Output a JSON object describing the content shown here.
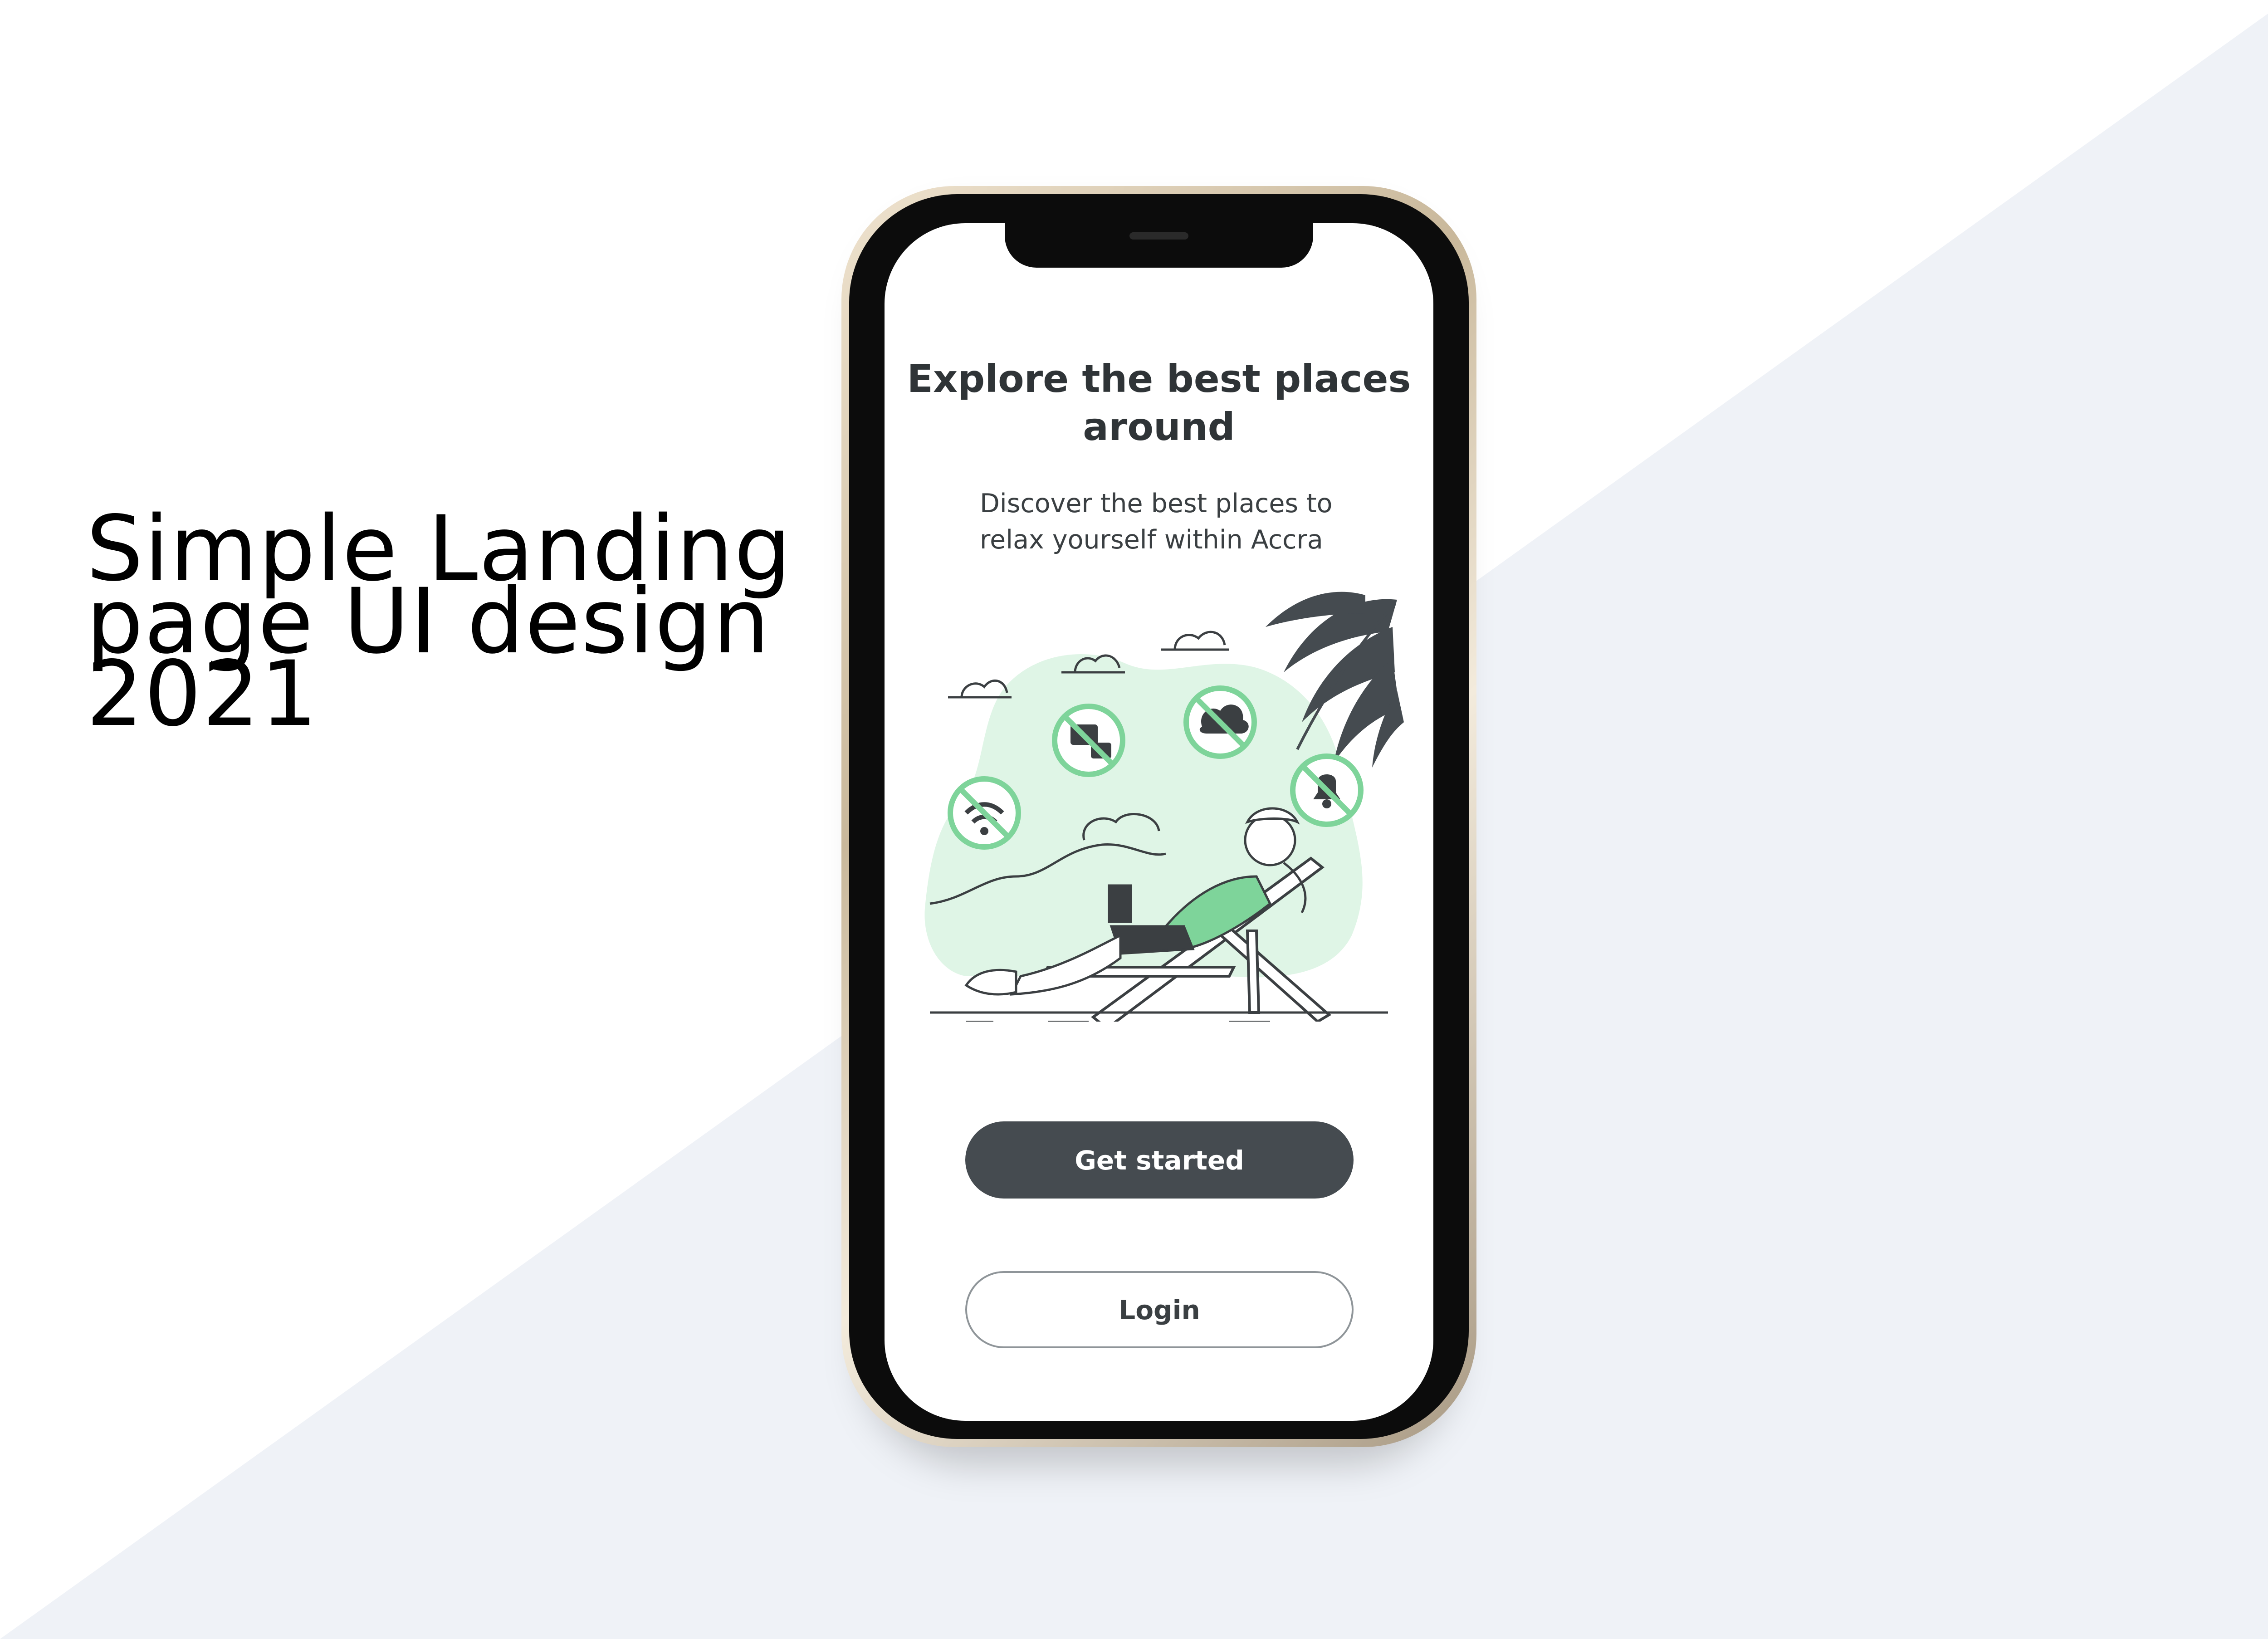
{
  "poster": {
    "headline_lines": [
      "Simple Landing",
      "page UI design",
      "2021"
    ]
  },
  "app": {
    "title_lines": [
      "Explore the best places",
      "around"
    ],
    "subtitle_lines": [
      "Discover the best places to",
      "relax yourself within Accra"
    ],
    "illustration_icons": [
      "no-wifi-icon",
      "no-messages-icon",
      "no-cloud-sync-icon",
      "no-notifications-icon",
      "palm-leaf-icon",
      "person-on-deck-chair"
    ],
    "buttons": {
      "primary": "Get started",
      "secondary": "Login"
    }
  },
  "colors": {
    "accent_green": "#dff5e6",
    "icon_green": "#7ed49a",
    "button_dark": "#454b50",
    "background_wedge": "#eff2f7"
  }
}
